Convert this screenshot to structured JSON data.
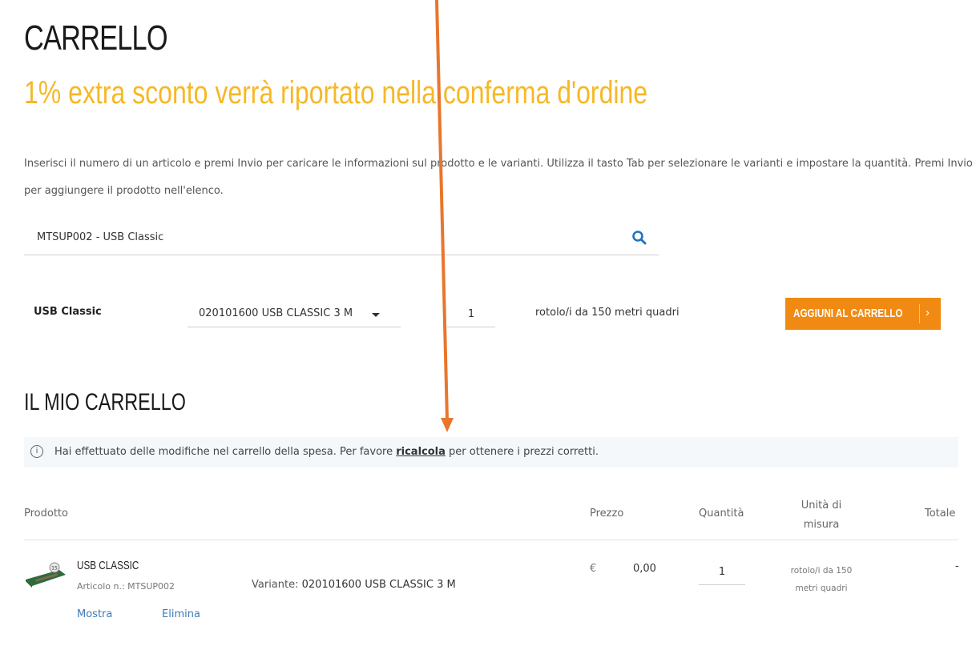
{
  "page": {
    "title": "CARRELLO",
    "promo": "1% extra sconto verrà riportato nella conferma d'ordine",
    "instructions": "Inserisci il numero di un articolo e premi Invio per caricare le informazioni sul prodotto e le varianti. Utilizza il tasto Tab per selezionare le varianti e impostare la quantità. Premi Invio per aggiungere il prodotto nell'elenco."
  },
  "search": {
    "value": "MTSUP002 - USB Classic",
    "icon": "search-icon"
  },
  "quick_add": {
    "product_label": "USB Classic",
    "variant_selected": "020101600 USB CLASSIC 3 M",
    "quantity": "1",
    "unit": "rotolo/i da 150 metri quadri",
    "add_button": "AGGIUNI AL CARRELLO",
    "chevron": "›"
  },
  "cart": {
    "title": "IL MIO CARRELLO",
    "notice_before": "Hai effettuato delle modifiche nel carrello della spesa. Per favore ",
    "notice_link": "ricalcola",
    "notice_after": " per ottenere i prezzi corretti.",
    "headers": {
      "product": "Prodotto",
      "price": "Prezzo",
      "quantity": "Quantità",
      "unit_line1": "Unità di",
      "unit_line2": "misura",
      "total": "Totale"
    },
    "items": [
      {
        "name": "USB CLASSIC",
        "sku": "Articolo n.: MTSUP002",
        "variant_label": "Variante:",
        "variant_value": "020101600 USB CLASSIC 3 M",
        "currency": "€",
        "price": "0,00",
        "quantity": "1",
        "unit_line1": "rotolo/i da 150",
        "unit_line2": "metri quadri",
        "total": "-",
        "show_link": "Mostra",
        "delete_link": "Elimina"
      }
    ]
  },
  "colors": {
    "promo": "#f6b827",
    "button": "#f18a12",
    "link": "#3d7ab7",
    "annotation_arrow": "#e8762d",
    "info_bg": "#f4f8fb"
  }
}
